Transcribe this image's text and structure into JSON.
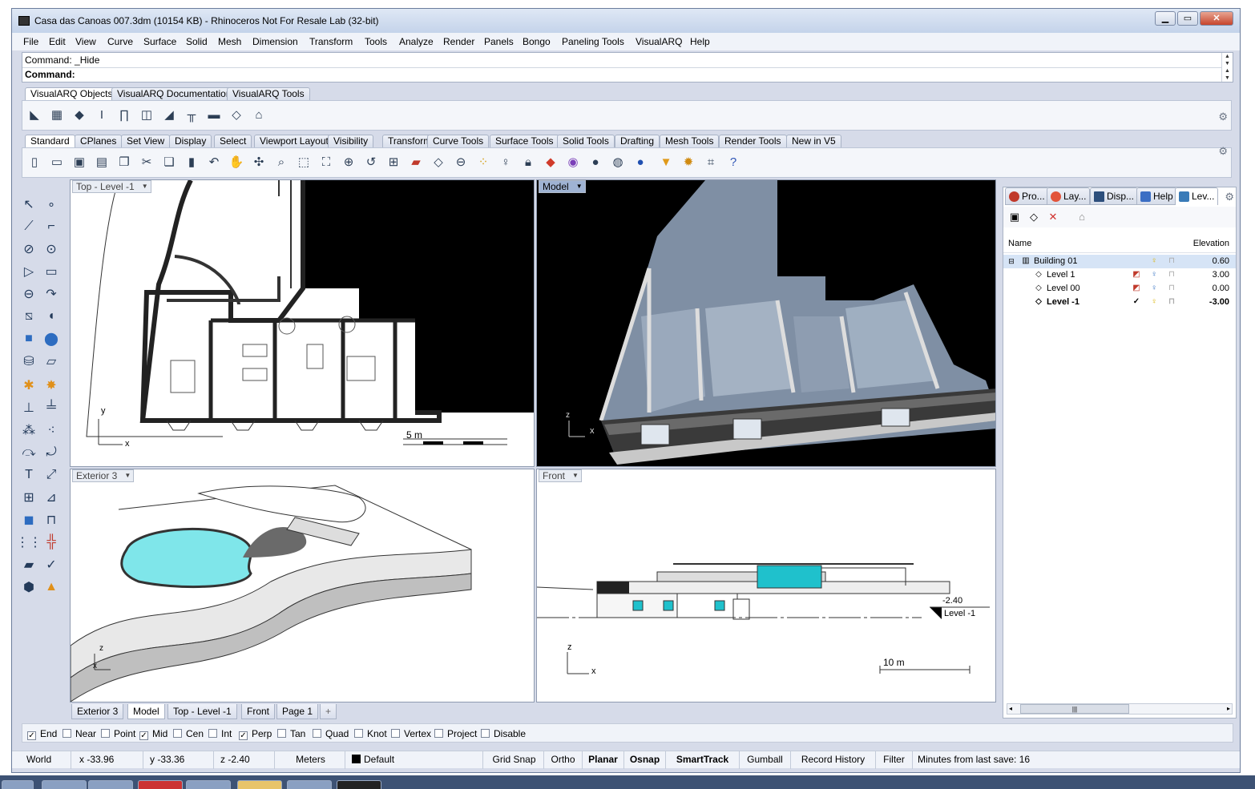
{
  "window": {
    "title": "Casa das Canoas 007.3dm (10154 KB) - Rhinoceros Not For Resale Lab (32-bit)",
    "minimize": "▁",
    "maximize": "▭",
    "close": "✕"
  },
  "menu": [
    "File",
    "Edit",
    "View",
    "Curve",
    "Surface",
    "Solid",
    "Mesh",
    "Dimension",
    "Transform",
    "Tools",
    "Analyze",
    "Render",
    "Panels",
    "Bongo",
    "Paneling Tools",
    "VisualARQ",
    "Help"
  ],
  "command": {
    "history": "Command: _Hide",
    "prompt": "Command:"
  },
  "visualarq_tabs": [
    "VisualARQ Objects",
    "VisualARQ Documentation",
    "VisualARQ Tools"
  ],
  "standard_tabs": [
    "Standard",
    "CPlanes",
    "Set View",
    "Display",
    "Select",
    "Viewport Layout",
    "Visibility",
    "Transform",
    "Curve Tools",
    "Surface Tools",
    "Solid Tools",
    "Drafting",
    "Mesh Tools",
    "Render Tools",
    "New in V5"
  ],
  "visualarq_icons": [
    "wall-icon",
    "curtain-wall-icon",
    "slab-icon",
    "column-icon",
    "door-icon",
    "window-icon",
    "stair-icon",
    "railing-icon",
    "beam-icon",
    "roof-icon",
    "level-icon"
  ],
  "standard_icons": [
    "new-icon",
    "open-icon",
    "save-icon",
    "print-icon",
    "import-icon",
    "cut-icon",
    "copy-icon",
    "paste-icon",
    "undo-icon",
    "pan-icon",
    "rotate-view-icon",
    "zoom-icon",
    "zoom-window-icon",
    "zoom-extents-icon",
    "zoom-selected-icon",
    "undo-view-icon",
    "four-viewports-icon",
    "car-icon",
    "cplane-icon",
    "osnap-icon",
    "select-points-icon",
    "light-icon",
    "lock-icon",
    "layer-icon",
    "color-icon",
    "render-icon",
    "rendered-sphere-icon",
    "material-icon",
    "spotlight-icon",
    "options-icon",
    "properties-icon",
    "help-icon"
  ],
  "viewports": {
    "top": {
      "label": "Top - Level -1",
      "scale": "5 m",
      "axis_x": "x",
      "axis_y": "y"
    },
    "model": {
      "label": "Model",
      "axis_x": "x",
      "axis_y": "z"
    },
    "exterior": {
      "label": "Exterior 3",
      "axis_x": "x",
      "axis_y": "z"
    },
    "front": {
      "label": "Front",
      "scale": "10 m",
      "axis_x": "x",
      "axis_y": "z",
      "elev_value": "-2.40",
      "elev_label": "Level -1"
    }
  },
  "viewport_tabs": [
    "Exterior 3",
    "Model",
    "Top - Level -1",
    "Front",
    "Page 1"
  ],
  "viewport_tab_add": "+",
  "panel": {
    "tabs": [
      {
        "label": "Pro...",
        "color": "#c0392b"
      },
      {
        "label": "Lay...",
        "color": "#e2533a"
      },
      {
        "label": "Disp...",
        "color": "#2d4f7c"
      },
      {
        "label": "Help",
        "color": "#3b6ec4"
      },
      {
        "label": "Lev...",
        "color": "#3a7bb8"
      }
    ],
    "col_name": "Name",
    "col_elevation": "Elevation",
    "collapse": "⊟",
    "levels": [
      {
        "name": "Building 01",
        "elevation": "0.60",
        "indent": 0
      },
      {
        "name": "Level 1",
        "elevation": "3.00",
        "indent": 1
      },
      {
        "name": "Level 00",
        "elevation": "0.00",
        "indent": 1
      },
      {
        "name": "Level -1",
        "elevation": "-3.00",
        "indent": 1
      }
    ],
    "scroll_left": "◂",
    "scroll_right": "▸",
    "scroll_thumb": "|||"
  },
  "osnaps": [
    {
      "label": "End",
      "checked": true
    },
    {
      "label": "Near",
      "checked": false
    },
    {
      "label": "Point",
      "checked": false
    },
    {
      "label": "Mid",
      "checked": true
    },
    {
      "label": "Cen",
      "checked": false
    },
    {
      "label": "Int",
      "checked": false
    },
    {
      "label": "Perp",
      "checked": true
    },
    {
      "label": "Tan",
      "checked": false
    },
    {
      "label": "Quad",
      "checked": false
    },
    {
      "label": "Knot",
      "checked": false
    },
    {
      "label": "Vertex",
      "checked": false
    },
    {
      "label": "Project",
      "checked": false
    },
    {
      "label": "Disable",
      "checked": false
    }
  ],
  "status": {
    "cplane": "World",
    "x": "x -33.96",
    "y": "y -33.36",
    "z": "z -2.40",
    "units": "Meters",
    "layer": "Default",
    "grid_snap": "Grid Snap",
    "ortho": "Ortho",
    "planar": "Planar",
    "osnap": "Osnap",
    "smarttrack": "SmartTrack",
    "gumball": "Gumball",
    "record_history": "Record History",
    "filter": "Filter",
    "save_info": "Minutes from last save: 16"
  },
  "colors": {
    "accent": "#9fb3d3",
    "pool": "#7fe6ea",
    "glass": "#1fc1cc"
  }
}
